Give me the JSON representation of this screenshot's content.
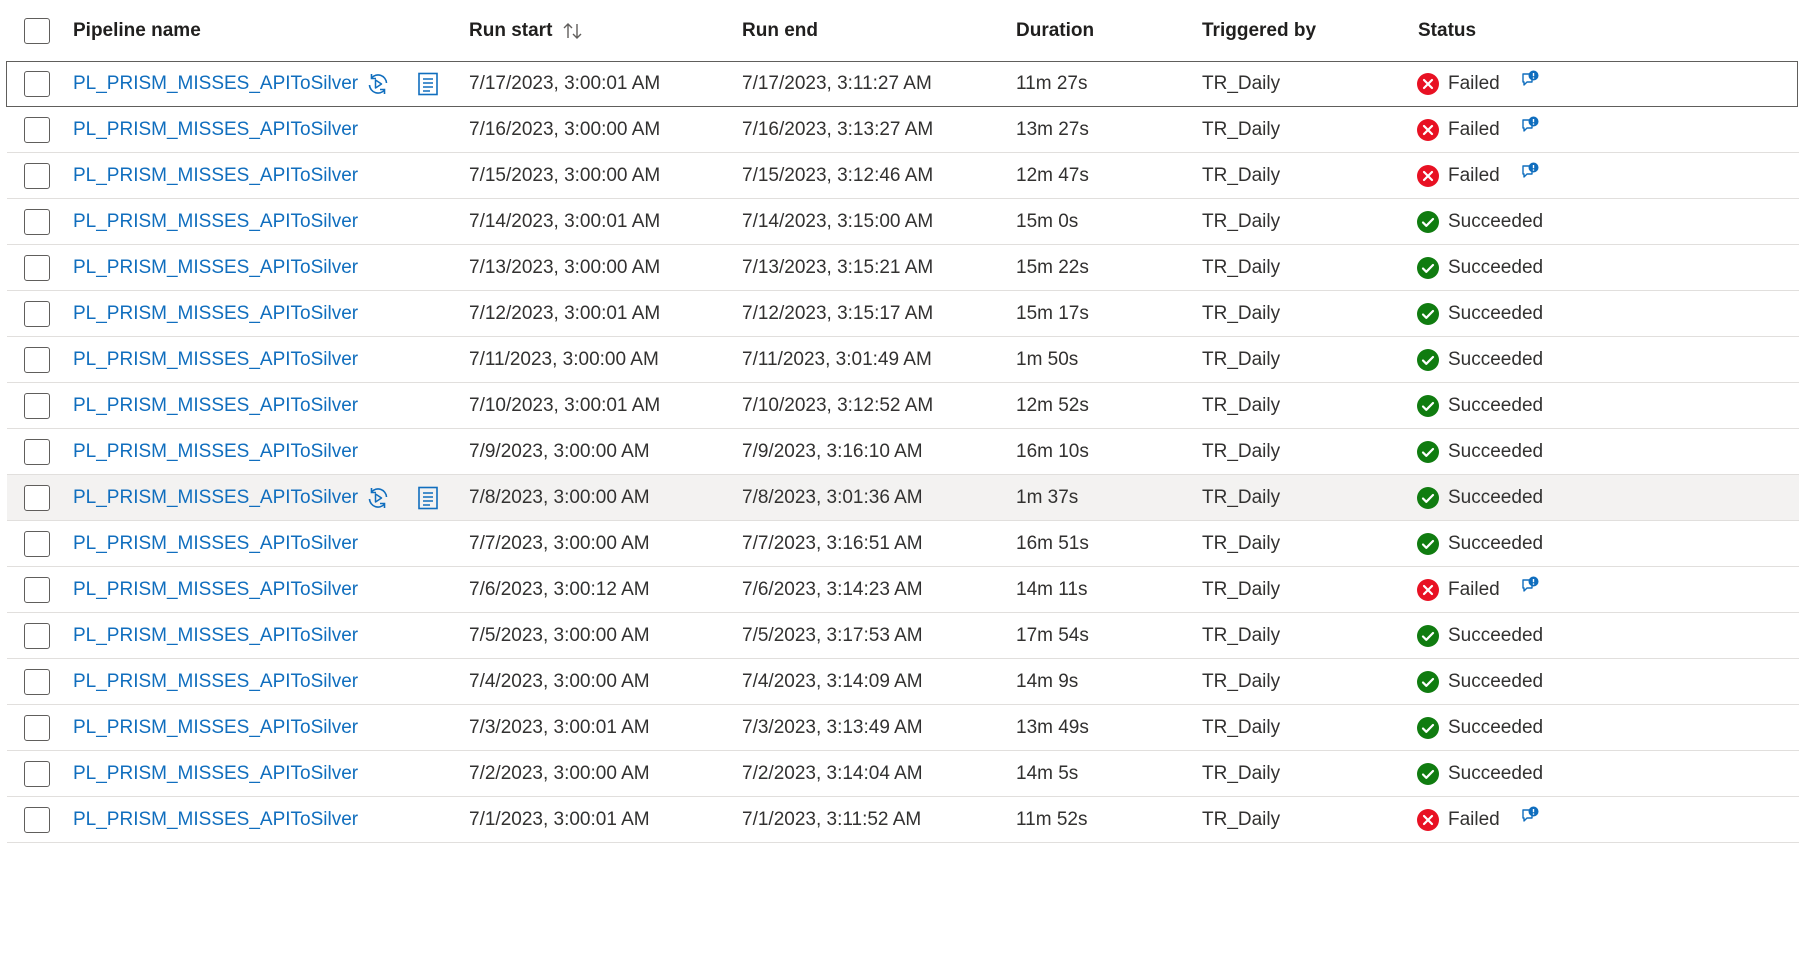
{
  "columns": {
    "pipeline_name": "Pipeline name",
    "run_start": "Run start",
    "run_end": "Run end",
    "duration": "Duration",
    "triggered_by": "Triggered by",
    "status": "Status"
  },
  "colors": {
    "link": "#106ebe",
    "failed": "#e81123",
    "succeeded": "#107c10",
    "hover_row": "#f3f2f1"
  },
  "rows": [
    {
      "name": "PL_PRISM_MISSES_APIToSilver",
      "start": "7/17/2023, 3:00:01 AM",
      "end": "7/17/2023, 3:11:27 AM",
      "duration": "11m 27s",
      "trigger": "TR_Daily",
      "status": "Failed"
    },
    {
      "name": "PL_PRISM_MISSES_APIToSilver",
      "start": "7/16/2023, 3:00:00 AM",
      "end": "7/16/2023, 3:13:27 AM",
      "duration": "13m 27s",
      "trigger": "TR_Daily",
      "status": "Failed"
    },
    {
      "name": "PL_PRISM_MISSES_APIToSilver",
      "start": "7/15/2023, 3:00:00 AM",
      "end": "7/15/2023, 3:12:46 AM",
      "duration": "12m 47s",
      "trigger": "TR_Daily",
      "status": "Failed"
    },
    {
      "name": "PL_PRISM_MISSES_APIToSilver",
      "start": "7/14/2023, 3:00:01 AM",
      "end": "7/14/2023, 3:15:00 AM",
      "duration": "15m 0s",
      "trigger": "TR_Daily",
      "status": "Succeeded"
    },
    {
      "name": "PL_PRISM_MISSES_APIToSilver",
      "start": "7/13/2023, 3:00:00 AM",
      "end": "7/13/2023, 3:15:21 AM",
      "duration": "15m 22s",
      "trigger": "TR_Daily",
      "status": "Succeeded"
    },
    {
      "name": "PL_PRISM_MISSES_APIToSilver",
      "start": "7/12/2023, 3:00:01 AM",
      "end": "7/12/2023, 3:15:17 AM",
      "duration": "15m 17s",
      "trigger": "TR_Daily",
      "status": "Succeeded"
    },
    {
      "name": "PL_PRISM_MISSES_APIToSilver",
      "start": "7/11/2023, 3:00:00 AM",
      "end": "7/11/2023, 3:01:49 AM",
      "duration": "1m 50s",
      "trigger": "TR_Daily",
      "status": "Succeeded"
    },
    {
      "name": "PL_PRISM_MISSES_APIToSilver",
      "start": "7/10/2023, 3:00:01 AM",
      "end": "7/10/2023, 3:12:52 AM",
      "duration": "12m 52s",
      "trigger": "TR_Daily",
      "status": "Succeeded"
    },
    {
      "name": "PL_PRISM_MISSES_APIToSilver",
      "start": "7/9/2023, 3:00:00 AM",
      "end": "7/9/2023, 3:16:10 AM",
      "duration": "16m 10s",
      "trigger": "TR_Daily",
      "status": "Succeeded"
    },
    {
      "name": "PL_PRISM_MISSES_APIToSilver",
      "start": "7/8/2023, 3:00:00 AM",
      "end": "7/8/2023, 3:01:36 AM",
      "duration": "1m 37s",
      "trigger": "TR_Daily",
      "status": "Succeeded"
    },
    {
      "name": "PL_PRISM_MISSES_APIToSilver",
      "start": "7/7/2023, 3:00:00 AM",
      "end": "7/7/2023, 3:16:51 AM",
      "duration": "16m 51s",
      "trigger": "TR_Daily",
      "status": "Succeeded"
    },
    {
      "name": "PL_PRISM_MISSES_APIToSilver",
      "start": "7/6/2023, 3:00:12 AM",
      "end": "7/6/2023, 3:14:23 AM",
      "duration": "14m 11s",
      "trigger": "TR_Daily",
      "status": "Failed"
    },
    {
      "name": "PL_PRISM_MISSES_APIToSilver",
      "start": "7/5/2023, 3:00:00 AM",
      "end": "7/5/2023, 3:17:53 AM",
      "duration": "17m 54s",
      "trigger": "TR_Daily",
      "status": "Succeeded"
    },
    {
      "name": "PL_PRISM_MISSES_APIToSilver",
      "start": "7/4/2023, 3:00:00 AM",
      "end": "7/4/2023, 3:14:09 AM",
      "duration": "14m 9s",
      "trigger": "TR_Daily",
      "status": "Succeeded"
    },
    {
      "name": "PL_PRISM_MISSES_APIToSilver",
      "start": "7/3/2023, 3:00:01 AM",
      "end": "7/3/2023, 3:13:49 AM",
      "duration": "13m 49s",
      "trigger": "TR_Daily",
      "status": "Succeeded"
    },
    {
      "name": "PL_PRISM_MISSES_APIToSilver",
      "start": "7/2/2023, 3:00:00 AM",
      "end": "7/2/2023, 3:14:04 AM",
      "duration": "14m 5s",
      "trigger": "TR_Daily",
      "status": "Succeeded"
    },
    {
      "name": "PL_PRISM_MISSES_APIToSilver",
      "start": "7/1/2023, 3:00:01 AM",
      "end": "7/1/2023, 3:11:52 AM",
      "duration": "11m 52s",
      "trigger": "TR_Daily",
      "status": "Failed"
    }
  ]
}
